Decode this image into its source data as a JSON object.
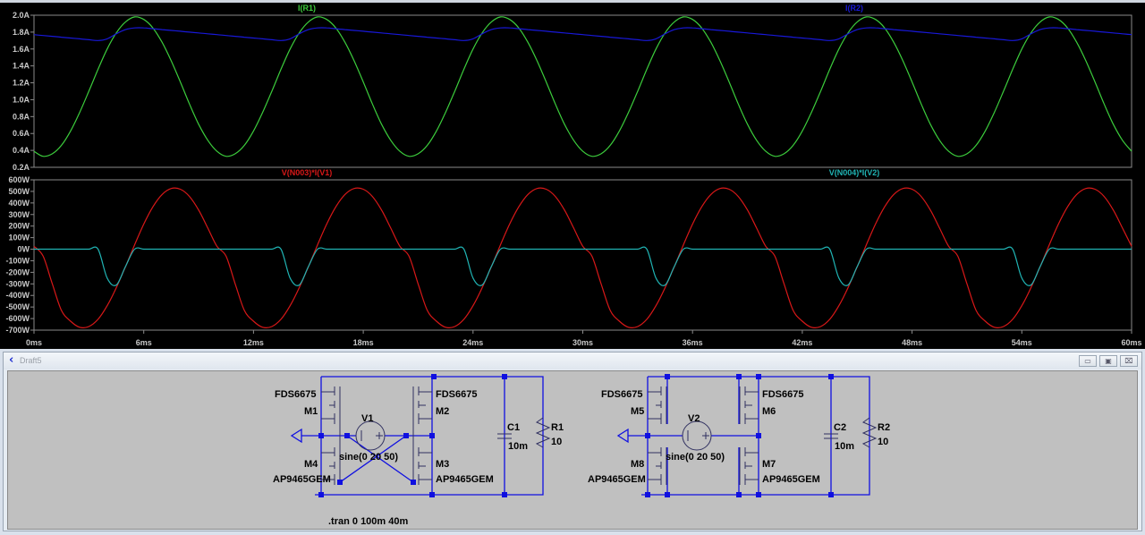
{
  "schematic_window": {
    "title": "Draft5",
    "buttons": {
      "minimize": "▭",
      "restore": "▣",
      "close": "⌧"
    },
    "icon": "ltspice-schematic-icon",
    "directive": ".tran 0 100m 40m",
    "circuit1": {
      "m1_model": "FDS6675",
      "m1": "M1",
      "m2_model": "FDS6675",
      "m2": "M2",
      "m3": "M3",
      "m3_model": "AP9465GEM",
      "m4": "M4",
      "m4_model": "AP9465GEM",
      "v": "V1",
      "v_value": "sine(0 20 50)",
      "c": "C1",
      "c_value": "10m",
      "r": "R1",
      "r_value": "10"
    },
    "circuit2": {
      "m5_model": "FDS6675",
      "m5": "M5",
      "m6_model": "FDS6675",
      "m6": "M6",
      "m7": "M7",
      "m7_model": "AP9465GEM",
      "m8": "M8",
      "m8_model": "AP9465GEM",
      "v": "V2",
      "v_value": "sine(0 20 50)",
      "c": "C2",
      "c_value": "10m",
      "r": "R2",
      "r_value": "10"
    },
    "wire_color": "#1010e0"
  },
  "chart_data": [
    {
      "type": "line",
      "pane": "top",
      "ylim": [
        0.2,
        2.0
      ],
      "yticks": [
        "2.0A",
        "1.8A",
        "1.6A",
        "1.4A",
        "1.2A",
        "1.0A",
        "0.8A",
        "0.6A",
        "0.4A",
        "0.2A"
      ],
      "xlim": [
        0,
        60
      ],
      "xticks": [
        "0ms",
        "6ms",
        "12ms",
        "18ms",
        "24ms",
        "30ms",
        "36ms",
        "42ms",
        "48ms",
        "54ms",
        "60ms"
      ],
      "background": "#000000",
      "grid": false,
      "x_ms": [
        0,
        0.5,
        1,
        1.5,
        2,
        2.5,
        3,
        3.5,
        4,
        4.5,
        5,
        5.5,
        6,
        6.5,
        7,
        7.5,
        8,
        8.5,
        9,
        9.5,
        10,
        10.5,
        11,
        11.5,
        12,
        12.5,
        13,
        13.5,
        14,
        14.5,
        15,
        15.5,
        16,
        16.5,
        17,
        17.5,
        18,
        18.5,
        19,
        19.5,
        20,
        20.5,
        21,
        21.5,
        22,
        22.5,
        23,
        23.5,
        24,
        24.5,
        25,
        25.5,
        26,
        26.5,
        27,
        27.5,
        28,
        28.5,
        29,
        29.5,
        30,
        30.5,
        31,
        31.5,
        32,
        32.5,
        33,
        33.5,
        34,
        34.5,
        35,
        35.5,
        36,
        36.5,
        37,
        37.5,
        38,
        38.5,
        39,
        39.5,
        40,
        40.5,
        41,
        41.5,
        42,
        42.5,
        43,
        43.5,
        44,
        44.5,
        45,
        45.5,
        46,
        46.5,
        47,
        47.5,
        48,
        48.5,
        49,
        49.5,
        50,
        50.5,
        51,
        51.5,
        52,
        52.5,
        53,
        53.5,
        54,
        54.5,
        55,
        55.5,
        56,
        56.5,
        57,
        57.5,
        58,
        58.5,
        59,
        59.5,
        60
      ],
      "series": [
        {
          "name": "I(R1)",
          "color": "#3ccc3c",
          "values": [
            0.39,
            0.33,
            0.36,
            0.46,
            0.63,
            0.85,
            1.1,
            1.36,
            1.6,
            1.79,
            1.92,
            1.98,
            1.95,
            1.85,
            1.68,
            1.46,
            1.21,
            0.95,
            0.71,
            0.52,
            0.39,
            0.33,
            0.36,
            0.46,
            0.63,
            0.85,
            1.1,
            1.36,
            1.6,
            1.79,
            1.92,
            1.98,
            1.95,
            1.85,
            1.68,
            1.46,
            1.21,
            0.95,
            0.71,
            0.52,
            0.39,
            0.33,
            0.36,
            0.46,
            0.63,
            0.85,
            1.1,
            1.36,
            1.6,
            1.79,
            1.92,
            1.98,
            1.95,
            1.85,
            1.68,
            1.46,
            1.21,
            0.95,
            0.71,
            0.52,
            0.39,
            0.33,
            0.36,
            0.46,
            0.63,
            0.85,
            1.1,
            1.36,
            1.6,
            1.79,
            1.92,
            1.98,
            1.95,
            1.85,
            1.68,
            1.46,
            1.21,
            0.95,
            0.71,
            0.52,
            0.39,
            0.33,
            0.36,
            0.46,
            0.63,
            0.85,
            1.1,
            1.36,
            1.6,
            1.79,
            1.92,
            1.98,
            1.95,
            1.85,
            1.68,
            1.46,
            1.21,
            0.95,
            0.71,
            0.52,
            0.39,
            0.33,
            0.36,
            0.46,
            0.63,
            0.85,
            1.1,
            1.36,
            1.6,
            1.79,
            1.92,
            1.98,
            1.95,
            1.85,
            1.68,
            1.46,
            1.21,
            0.95,
            0.71,
            0.52,
            0.39
          ]
        },
        {
          "name": "I(R2)",
          "color": "#1818d8",
          "values": [
            1.77,
            1.76,
            1.75,
            1.74,
            1.73,
            1.72,
            1.71,
            1.7,
            1.72,
            1.78,
            1.83,
            1.85,
            1.85,
            1.84,
            1.83,
            1.82,
            1.81,
            1.8,
            1.79,
            1.78,
            1.77,
            1.76,
            1.75,
            1.74,
            1.73,
            1.72,
            1.71,
            1.7,
            1.72,
            1.78,
            1.83,
            1.85,
            1.85,
            1.84,
            1.83,
            1.82,
            1.81,
            1.8,
            1.79,
            1.78,
            1.77,
            1.76,
            1.75,
            1.74,
            1.73,
            1.72,
            1.71,
            1.7,
            1.72,
            1.78,
            1.83,
            1.85,
            1.85,
            1.84,
            1.83,
            1.82,
            1.81,
            1.8,
            1.79,
            1.78,
            1.77,
            1.76,
            1.75,
            1.74,
            1.73,
            1.72,
            1.71,
            1.7,
            1.72,
            1.78,
            1.83,
            1.85,
            1.85,
            1.84,
            1.83,
            1.82,
            1.81,
            1.8,
            1.79,
            1.78,
            1.77,
            1.76,
            1.75,
            1.74,
            1.73,
            1.72,
            1.71,
            1.7,
            1.72,
            1.78,
            1.83,
            1.85,
            1.85,
            1.84,
            1.83,
            1.82,
            1.81,
            1.8,
            1.79,
            1.78,
            1.77,
            1.76,
            1.75,
            1.74,
            1.73,
            1.72,
            1.71,
            1.7,
            1.72,
            1.78,
            1.83,
            1.85,
            1.85,
            1.84,
            1.83,
            1.82,
            1.81,
            1.8,
            1.79,
            1.78,
            1.77
          ]
        }
      ]
    },
    {
      "type": "line",
      "pane": "bottom",
      "ylim": [
        -700,
        600
      ],
      "yticks": [
        "600W",
        "500W",
        "400W",
        "300W",
        "200W",
        "100W",
        "0W",
        "-100W",
        "-200W",
        "-300W",
        "-400W",
        "-500W",
        "-600W",
        "-700W"
      ],
      "xlim": [
        0,
        60
      ],
      "background": "#000000",
      "grid": false,
      "series": [
        {
          "name": "V(N003)*I(V1)",
          "color": "#d81818",
          "values": [
            25,
            -60,
            -300,
            -530,
            -623,
            -675,
            -669,
            -606,
            -489,
            -333,
            -151,
            38,
            217,
            366,
            473,
            525,
            519,
            456,
            339,
            183,
            25,
            -60,
            -300,
            -530,
            -623,
            -675,
            -669,
            -606,
            -489,
            -333,
            -151,
            38,
            217,
            366,
            473,
            525,
            519,
            456,
            339,
            183,
            25,
            -60,
            -300,
            -530,
            -623,
            -675,
            -669,
            -606,
            -489,
            -333,
            -151,
            38,
            217,
            366,
            473,
            525,
            519,
            456,
            339,
            183,
            25,
            -60,
            -300,
            -530,
            -623,
            -675,
            -669,
            -606,
            -489,
            -333,
            -151,
            38,
            217,
            366,
            473,
            525,
            519,
            456,
            339,
            183,
            25,
            -60,
            -300,
            -530,
            -623,
            -675,
            -669,
            -606,
            -489,
            -333,
            -151,
            38,
            217,
            366,
            473,
            525,
            519,
            456,
            339,
            183,
            25,
            -60,
            -300,
            -530,
            -623,
            -675,
            -669,
            -606,
            -489,
            -333,
            -151,
            38,
            217,
            366,
            473,
            525,
            519,
            456,
            339,
            183,
            25
          ]
        },
        {
          "name": "V(N004)*I(V2)",
          "color": "#20b4b4",
          "values": [
            0,
            0,
            0,
            0,
            0,
            0,
            0,
            0,
            -250,
            -310,
            -150,
            0,
            0,
            0,
            0,
            0,
            0,
            0,
            0,
            0,
            0,
            0,
            0,
            0,
            0,
            0,
            0,
            0,
            -250,
            -310,
            -150,
            0,
            0,
            0,
            0,
            0,
            0,
            0,
            0,
            0,
            0,
            0,
            0,
            0,
            0,
            0,
            0,
            0,
            -250,
            -310,
            -150,
            0,
            0,
            0,
            0,
            0,
            0,
            0,
            0,
            0,
            0,
            0,
            0,
            0,
            0,
            0,
            0,
            0,
            -250,
            -310,
            -150,
            0,
            0,
            0,
            0,
            0,
            0,
            0,
            0,
            0,
            0,
            0,
            0,
            0,
            0,
            0,
            0,
            0,
            -250,
            -310,
            -150,
            0,
            0,
            0,
            0,
            0,
            0,
            0,
            0,
            0,
            0,
            0,
            0,
            0,
            0,
            0,
            0,
            0,
            -250,
            -310,
            -150,
            0,
            0,
            0,
            0,
            0,
            0,
            0,
            0,
            0,
            0
          ]
        }
      ]
    }
  ]
}
